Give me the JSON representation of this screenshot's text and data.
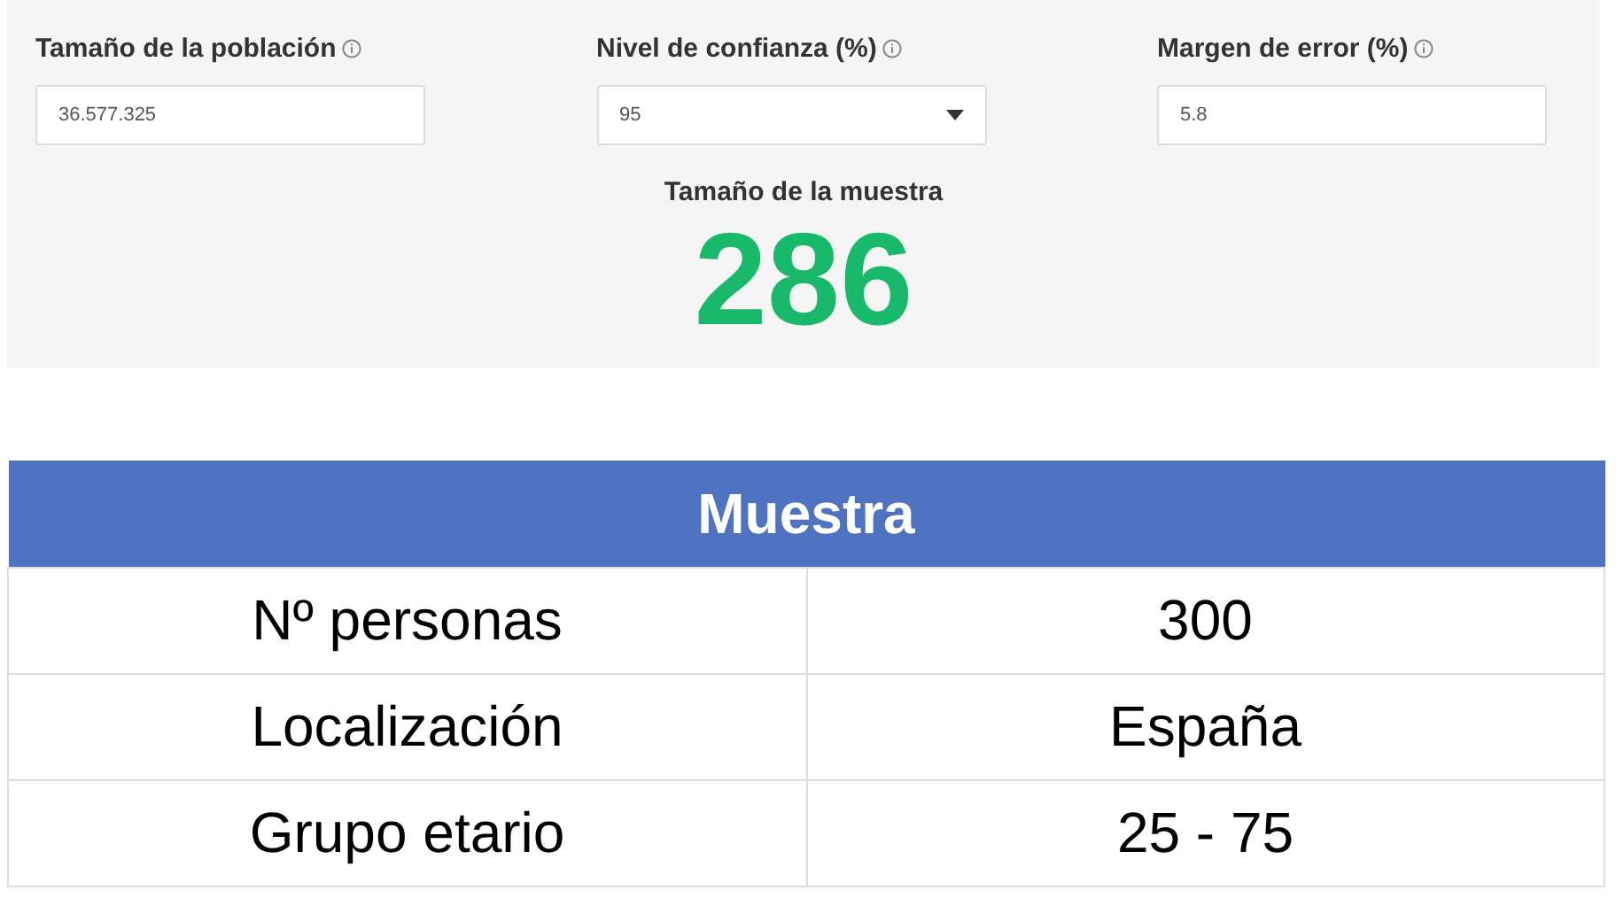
{
  "calculator": {
    "fields": [
      {
        "label": "Tamaño de la población",
        "kind": "text",
        "value": "36.577.325"
      },
      {
        "label": "Nivel de confianza (%)",
        "kind": "select",
        "value": "95"
      },
      {
        "label": "Margen de error (%)",
        "kind": "text",
        "value": "5.8"
      }
    ],
    "result_label": "Tamaño de la muestra",
    "result_value": "286"
  },
  "table": {
    "title": "Muestra",
    "rows": [
      [
        "Nº personas",
        "300"
      ],
      [
        "Localización",
        "España"
      ],
      [
        "Grupo etario",
        "25 - 75"
      ]
    ]
  }
}
